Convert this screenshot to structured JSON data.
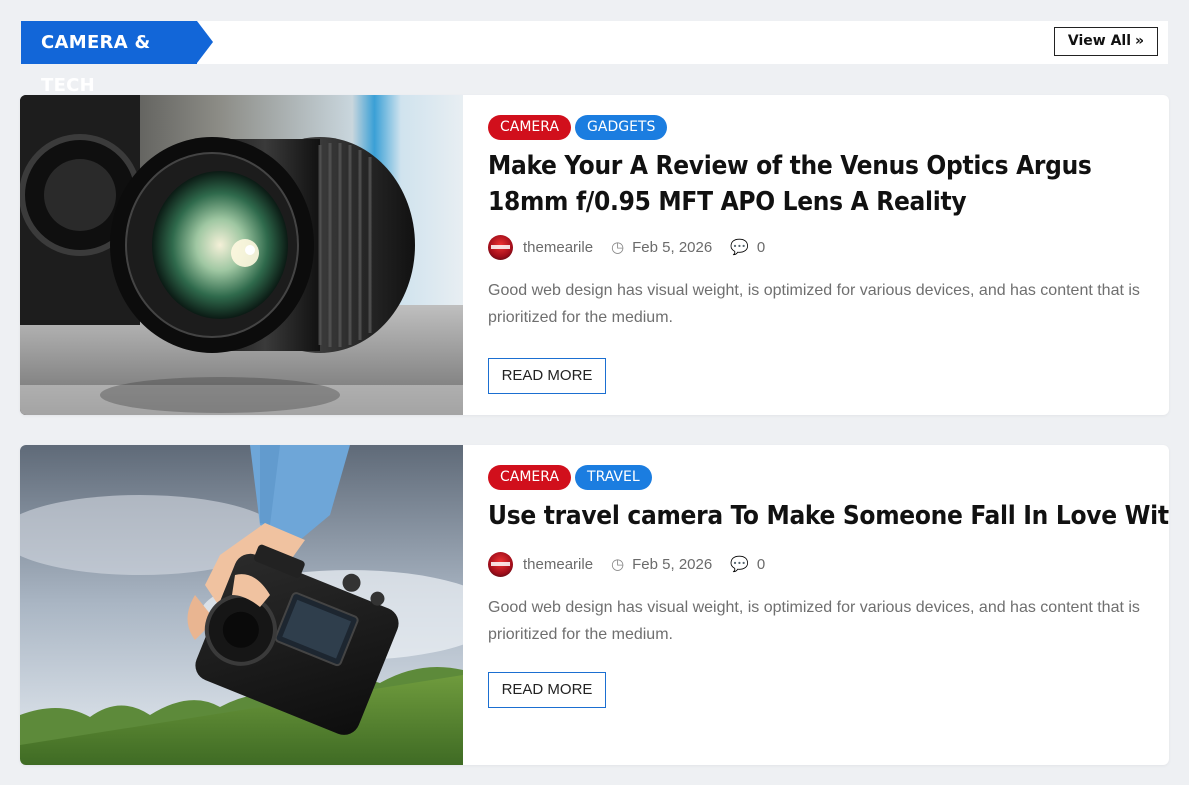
{
  "section": {
    "title": "CAMERA & TECH",
    "view_all_label": "View All",
    "view_all_icon": "double-chevron-right-icon",
    "accent_color": "#1266d8"
  },
  "posts": [
    {
      "categories": [
        {
          "label": "CAMERA",
          "color": "#d10f1c"
        },
        {
          "label": "GADGETS",
          "color": "#1b7de0"
        }
      ],
      "title": "Make Your A Review of the Venus Optics Argus 18mm f/0.95 MFT APO Lens A Reality",
      "author": "themearile",
      "date": "Feb 5, 2026",
      "comments": "0",
      "excerpt": "Good web design has visual weight, is optimized for various devices, and has content that is prioritized for the medium.",
      "read_more_label": "READ MORE",
      "image": "camera-lens-photo"
    },
    {
      "categories": [
        {
          "label": "CAMERA",
          "color": "#d10f1c"
        },
        {
          "label": "TRAVEL",
          "color": "#1b7de0"
        }
      ],
      "title": "Use travel camera To Make Someone Fall In Love With You",
      "author": "themearile",
      "date": "Feb 5, 2026",
      "comments": "0",
      "excerpt": "Good web design has visual weight, is optimized for various devices, and has content that is prioritized for the medium.",
      "read_more_label": "READ MORE",
      "image": "hand-holding-camera-photo"
    }
  ]
}
